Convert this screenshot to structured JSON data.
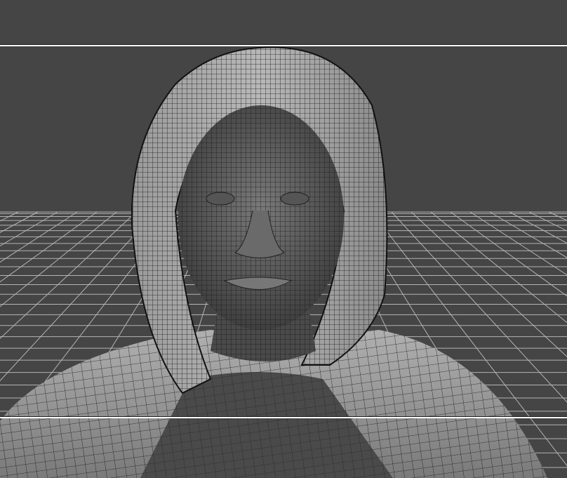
{
  "viewport": {
    "background": "#454545",
    "grid_color": "#b4b4b4",
    "mesh_fill": "#8a8a8a",
    "wire_color": "#1a1a1a",
    "frame_line_color": "#ffffff"
  },
  "scene": {
    "subject": "hooded-figure-wireframe",
    "display_mode": "wireframe-on-shaded"
  }
}
